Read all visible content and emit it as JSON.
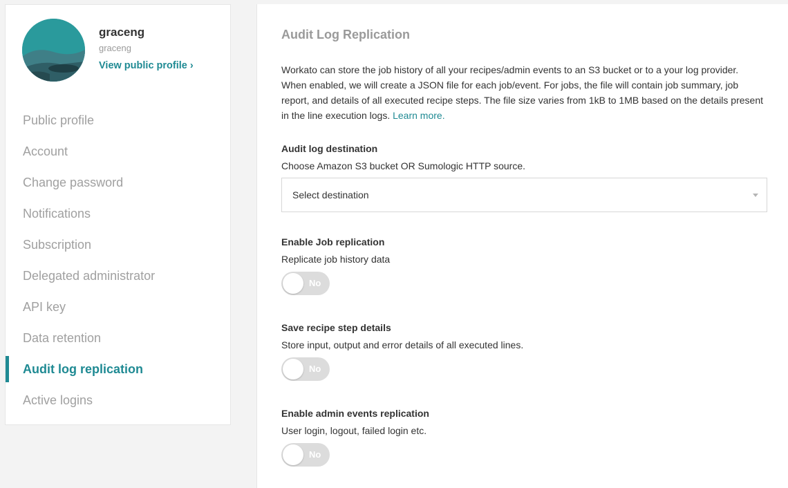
{
  "profile": {
    "name": "graceng",
    "handle": "graceng",
    "view_profile_label": "View public profile ›"
  },
  "sidebar": {
    "items": [
      {
        "label": "Public profile",
        "active": false
      },
      {
        "label": "Account",
        "active": false
      },
      {
        "label": "Change password",
        "active": false
      },
      {
        "label": "Notifications",
        "active": false
      },
      {
        "label": "Subscription",
        "active": false
      },
      {
        "label": "Delegated administrator",
        "active": false
      },
      {
        "label": "API key",
        "active": false
      },
      {
        "label": "Data retention",
        "active": false
      },
      {
        "label": "Audit log replication",
        "active": true
      },
      {
        "label": "Active logins",
        "active": false
      }
    ]
  },
  "main": {
    "title": "Audit Log Replication",
    "intro_text": "Workato can store the job history of all your recipes/admin events to an S3 bucket or to a your log provider. When enabled, we will create a JSON file for each job/event. For jobs, the file will contain job summary, job report, and details of all executed recipe steps. The file size varies from 1kB to 1MB based on the details present in the line execution logs.",
    "learn_more": "Learn more.",
    "destination": {
      "title": "Audit log destination",
      "description": "Choose Amazon S3 bucket OR Sumologic HTTP source.",
      "select_value": "Select destination"
    },
    "job_replication": {
      "title": "Enable Job replication",
      "description": "Replicate job history data",
      "toggle_label": "No"
    },
    "recipe_steps": {
      "title": "Save recipe step details",
      "description": "Store input, output and error details of all executed lines.",
      "toggle_label": "No"
    },
    "admin_events": {
      "title": "Enable admin events replication",
      "description": "User login, logout, failed login etc.",
      "toggle_label": "No"
    }
  },
  "colors": {
    "accent": "#1f8a93",
    "avatar_bg": "#2a9a9c",
    "toggle_off": "#dcdcdc"
  }
}
